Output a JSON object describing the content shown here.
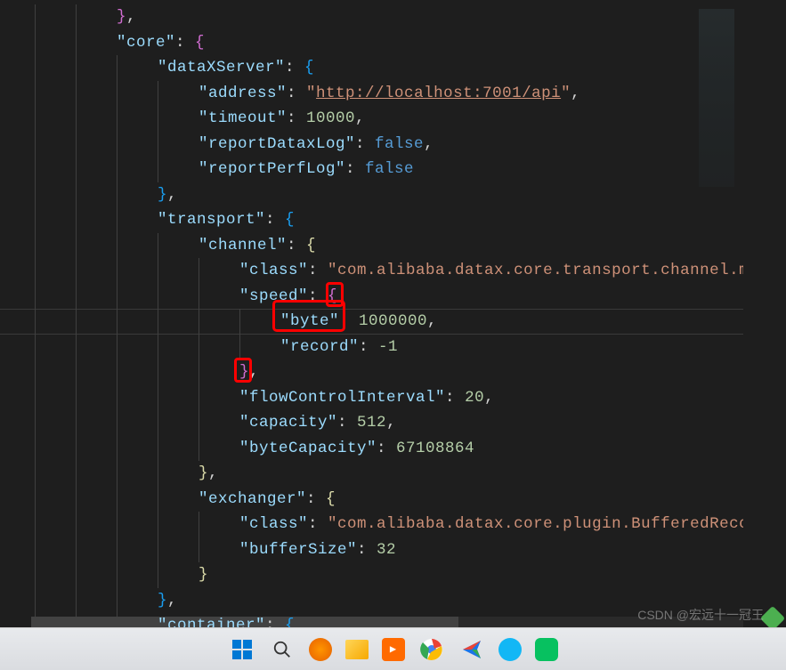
{
  "code": {
    "lines": [
      {
        "indent": 2,
        "parts": [
          {
            "t": "brace-pink",
            "v": "}"
          },
          {
            "t": "punct",
            "v": ","
          }
        ]
      },
      {
        "indent": 2,
        "parts": [
          {
            "t": "key",
            "v": "\"core\""
          },
          {
            "t": "punct",
            "v": ": "
          },
          {
            "t": "brace-pink",
            "v": "{"
          }
        ]
      },
      {
        "indent": 3,
        "parts": [
          {
            "t": "key",
            "v": "\"dataXServer\""
          },
          {
            "t": "punct",
            "v": ": "
          },
          {
            "t": "brace-blue",
            "v": "{"
          }
        ]
      },
      {
        "indent": 4,
        "parts": [
          {
            "t": "key",
            "v": "\"address\""
          },
          {
            "t": "punct",
            "v": ": "
          },
          {
            "t": "string",
            "v": "\""
          },
          {
            "t": "url",
            "v": "http://localhost:7001/api"
          },
          {
            "t": "string",
            "v": "\""
          },
          {
            "t": "punct",
            "v": ","
          }
        ]
      },
      {
        "indent": 4,
        "parts": [
          {
            "t": "key",
            "v": "\"timeout\""
          },
          {
            "t": "punct",
            "v": ": "
          },
          {
            "t": "number",
            "v": "10000"
          },
          {
            "t": "punct",
            "v": ","
          }
        ]
      },
      {
        "indent": 4,
        "parts": [
          {
            "t": "key",
            "v": "\"reportDataxLog\""
          },
          {
            "t": "punct",
            "v": ": "
          },
          {
            "t": "bool",
            "v": "false"
          },
          {
            "t": "punct",
            "v": ","
          }
        ]
      },
      {
        "indent": 4,
        "parts": [
          {
            "t": "key",
            "v": "\"reportPerfLog\""
          },
          {
            "t": "punct",
            "v": ": "
          },
          {
            "t": "bool",
            "v": "false"
          }
        ]
      },
      {
        "indent": 3,
        "parts": [
          {
            "t": "brace-blue",
            "v": "}"
          },
          {
            "t": "punct",
            "v": ","
          }
        ]
      },
      {
        "indent": 3,
        "parts": [
          {
            "t": "key",
            "v": "\"transport\""
          },
          {
            "t": "punct",
            "v": ": "
          },
          {
            "t": "brace-blue",
            "v": "{"
          }
        ]
      },
      {
        "indent": 4,
        "parts": [
          {
            "t": "key",
            "v": "\"channel\""
          },
          {
            "t": "punct",
            "v": ": "
          },
          {
            "t": "brace",
            "v": "{"
          }
        ]
      },
      {
        "indent": 5,
        "parts": [
          {
            "t": "key",
            "v": "\"class\""
          },
          {
            "t": "punct",
            "v": ": "
          },
          {
            "t": "string",
            "v": "\"com.alibaba.datax.core.transport.channel.me"
          }
        ]
      },
      {
        "indent": 5,
        "parts": [
          {
            "t": "key",
            "v": "\"speed\""
          },
          {
            "t": "punct",
            "v": ": "
          },
          {
            "t": "brace-pink",
            "v": "{"
          }
        ]
      },
      {
        "indent": 6,
        "highlight": true,
        "redbox": true,
        "parts": [
          {
            "t": "key",
            "v": "\"byte\""
          },
          {
            "t": "punct",
            "v": ": "
          },
          {
            "t": "number",
            "v": "1000000"
          },
          {
            "t": "punct",
            "v": ","
          }
        ]
      },
      {
        "indent": 6,
        "parts": [
          {
            "t": "key",
            "v": "\"record\""
          },
          {
            "t": "punct",
            "v": ": "
          },
          {
            "t": "number",
            "v": "-1"
          }
        ]
      },
      {
        "indent": 5,
        "parts": [
          {
            "t": "brace-pink",
            "v": "}"
          },
          {
            "t": "punct",
            "v": ","
          }
        ]
      },
      {
        "indent": 5,
        "parts": [
          {
            "t": "key",
            "v": "\"flowControlInterval\""
          },
          {
            "t": "punct",
            "v": ": "
          },
          {
            "t": "number",
            "v": "20"
          },
          {
            "t": "punct",
            "v": ","
          }
        ]
      },
      {
        "indent": 5,
        "parts": [
          {
            "t": "key",
            "v": "\"capacity\""
          },
          {
            "t": "punct",
            "v": ": "
          },
          {
            "t": "number",
            "v": "512"
          },
          {
            "t": "punct",
            "v": ","
          }
        ]
      },
      {
        "indent": 5,
        "parts": [
          {
            "t": "key",
            "v": "\"byteCapacity\""
          },
          {
            "t": "punct",
            "v": ": "
          },
          {
            "t": "number",
            "v": "67108864"
          }
        ]
      },
      {
        "indent": 4,
        "parts": [
          {
            "t": "brace",
            "v": "}"
          },
          {
            "t": "punct",
            "v": ","
          }
        ]
      },
      {
        "indent": 4,
        "parts": [
          {
            "t": "key",
            "v": "\"exchanger\""
          },
          {
            "t": "punct",
            "v": ": "
          },
          {
            "t": "brace",
            "v": "{"
          }
        ]
      },
      {
        "indent": 5,
        "parts": [
          {
            "t": "key",
            "v": "\"class\""
          },
          {
            "t": "punct",
            "v": ": "
          },
          {
            "t": "string",
            "v": "\"com.alibaba.datax.core.plugin.BufferedRecor"
          }
        ]
      },
      {
        "indent": 5,
        "parts": [
          {
            "t": "key",
            "v": "\"bufferSize\""
          },
          {
            "t": "punct",
            "v": ": "
          },
          {
            "t": "number",
            "v": "32"
          }
        ]
      },
      {
        "indent": 4,
        "parts": [
          {
            "t": "brace",
            "v": "}"
          }
        ]
      },
      {
        "indent": 3,
        "parts": [
          {
            "t": "brace-blue",
            "v": "}"
          },
          {
            "t": "punct",
            "v": ","
          }
        ]
      },
      {
        "indent": 3,
        "parts": [
          {
            "t": "key",
            "v": "\"container\""
          },
          {
            "t": "punct",
            "v": ": "
          },
          {
            "t": "brace-blue",
            "v": "{"
          }
        ]
      }
    ]
  },
  "watermark": "CSDN @宏远十一冠王",
  "indentSize": 46,
  "baseIndent": 39
}
